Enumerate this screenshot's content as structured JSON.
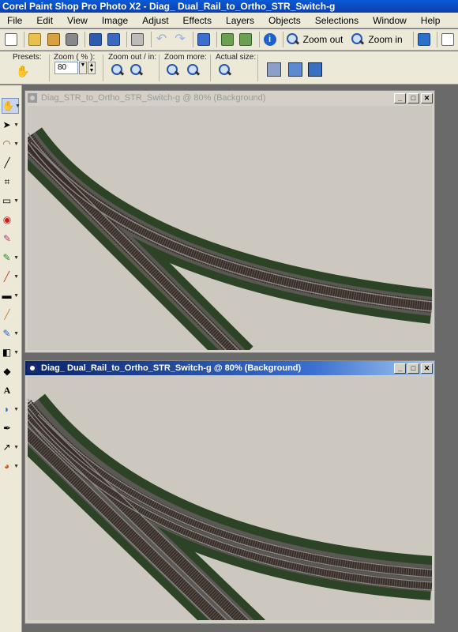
{
  "app": {
    "title": "Corel Paint Shop Pro Photo X2 - Diag_ Dual_Rail_to_Ortho_STR_Switch-g"
  },
  "menu": {
    "items": [
      {
        "label": "File"
      },
      {
        "label": "Edit"
      },
      {
        "label": "View"
      },
      {
        "label": "Image"
      },
      {
        "label": "Adjust"
      },
      {
        "label": "Effects"
      },
      {
        "label": "Layers"
      },
      {
        "label": "Objects"
      },
      {
        "label": "Selections"
      },
      {
        "label": "Window"
      },
      {
        "label": "Help"
      }
    ]
  },
  "toolbar": {
    "zoom_out_label": "Zoom out",
    "zoom_in_label": "Zoom in"
  },
  "options": {
    "presets_label": "Presets:",
    "zoom_label": "Zoom ( % ):",
    "zoom_value": "80",
    "zoom_out_in_label": "Zoom out / in:",
    "zoom_more_label": "Zoom more:",
    "actual_size_label": "Actual size:"
  },
  "windows": [
    {
      "title": "Diag_STR_to_Ortho_STR_Switch-g @  80% (Background)",
      "active": false
    },
    {
      "title": "Diag_ Dual_Rail_to_Ortho_STR_Switch-g @  80% (Background)",
      "active": true
    }
  ],
  "colors": {
    "canvas_bg": "#cdc8bf",
    "grass": "#2d4325",
    "ballast": "#5a5852",
    "ties": "#3a2c26",
    "rail": "#8a8a88",
    "active_title": "#0a246a"
  },
  "icons": {
    "window_controls": [
      "minimize-icon",
      "maximize-icon",
      "close-icon"
    ]
  }
}
